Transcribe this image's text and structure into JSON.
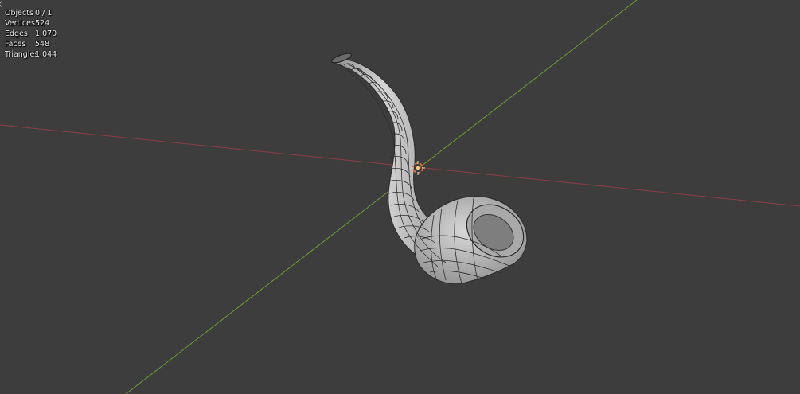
{
  "viewport": {
    "background_color": "#3d3d3d",
    "x_axis_color": "#8a3f47",
    "y_axis_color": "#6f9a37"
  },
  "stats": {
    "objects": {
      "label": "Objects",
      "value": "0 / 1"
    },
    "vertices": {
      "label": "Vertices",
      "value": "524"
    },
    "edges": {
      "label": "Edges",
      "value": "1,070"
    },
    "faces": {
      "label": "Faces",
      "value": "548"
    },
    "triangles": {
      "label": "Triangles",
      "value": "1,044"
    }
  },
  "scene": {
    "object": "pipe-mesh",
    "origin_marker": "3d-cursor-icon"
  }
}
